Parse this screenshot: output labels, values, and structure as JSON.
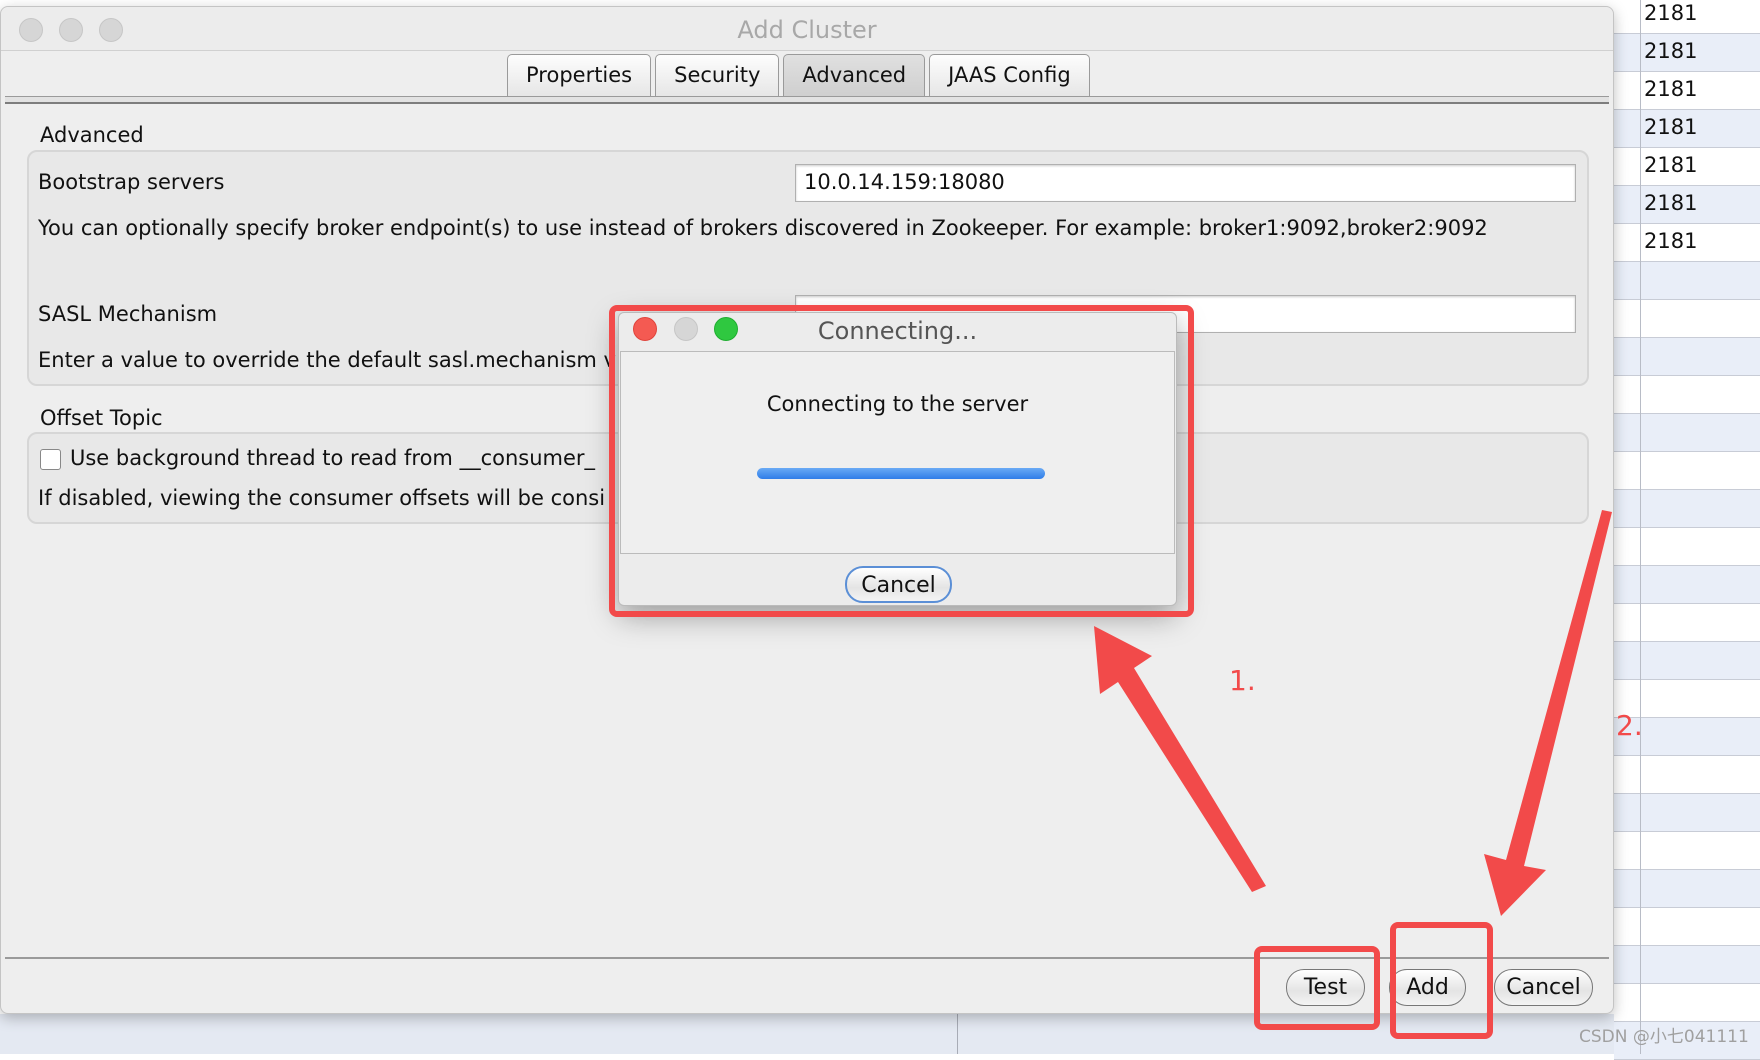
{
  "window": {
    "title": "Add Cluster"
  },
  "tabs": [
    {
      "label": "Properties"
    },
    {
      "label": "Security"
    },
    {
      "label": "Advanced",
      "active": true
    },
    {
      "label": "JAAS Config"
    }
  ],
  "advanced": {
    "section_label": "Advanced",
    "bootstrap_label": "Bootstrap servers",
    "bootstrap_value": "10.0.14.159:18080",
    "bootstrap_help": "You can optionally specify broker endpoint(s) to use instead of brokers discovered in Zookeeper. For example: broker1:9092,broker2:9092",
    "sasl_label": "SASL Mechanism",
    "sasl_value": "",
    "sasl_help": "Enter a value to override the default sasl.mechanism v"
  },
  "offset": {
    "section_label": "Offset Topic",
    "checkbox_label": "Use background thread to read from __consumer_",
    "checked": false,
    "help": "If disabled, viewing the consumer offsets will be consi"
  },
  "buttons": {
    "test": "Test",
    "add": "Add",
    "cancel": "Cancel"
  },
  "dialog": {
    "title": "Connecting...",
    "message": "Connecting to the server",
    "cancel": "Cancel",
    "progress": "indeterminate"
  },
  "background_table": {
    "values": [
      "2181",
      "2181",
      "2181",
      "2181",
      "2181",
      "2181",
      "2181"
    ]
  },
  "annotations": {
    "one": "1.",
    "two": "2.",
    "color": "#f24a4a"
  },
  "watermark": "CSDN @小七041111"
}
